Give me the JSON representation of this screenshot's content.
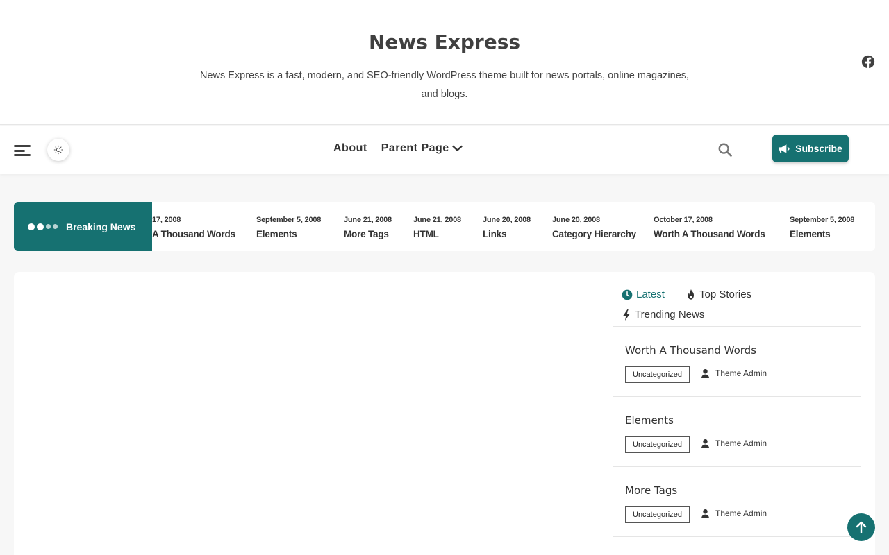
{
  "site": {
    "title": "News Express",
    "description": "News Express is a fast, modern, and SEO-friendly WordPress theme built for news portals, online magazines, and blogs."
  },
  "nav": {
    "items": [
      {
        "label": "About",
        "has_dropdown": false
      },
      {
        "label": "Parent Page",
        "has_dropdown": true
      }
    ],
    "subscribe_label": "Subscribe"
  },
  "breaking": {
    "label": "Breaking News",
    "items": [
      {
        "date": "17, 2008",
        "title": "A Thousand Words"
      },
      {
        "date": "September 5, 2008",
        "title": "Elements"
      },
      {
        "date": "June 21, 2008",
        "title": "More Tags"
      },
      {
        "date": "June 21, 2008",
        "title": "HTML"
      },
      {
        "date": "June 20, 2008",
        "title": "Links"
      },
      {
        "date": "June 20, 2008",
        "title": "Category Hierarchy"
      },
      {
        "date": "October 17, 2008",
        "title": "Worth A Thousand Words"
      },
      {
        "date": "September 5, 2008",
        "title": "Elements"
      }
    ]
  },
  "tabs": [
    {
      "label": "Latest",
      "icon": "clock-icon",
      "active": true
    },
    {
      "label": "Top Stories",
      "icon": "fire-icon",
      "active": false
    },
    {
      "label": "Trending News",
      "icon": "bolt-icon",
      "active": false
    }
  ],
  "posts": [
    {
      "title": "Worth A Thousand Words",
      "category": "Uncategorized",
      "author": "Theme Admin"
    },
    {
      "title": "Elements",
      "category": "Uncategorized",
      "author": "Theme Admin"
    },
    {
      "title": "More Tags",
      "category": "Uncategorized",
      "author": "Theme Admin"
    }
  ],
  "colors": {
    "accent": "#167171",
    "text": "#333333",
    "background": "#f7f7f7"
  }
}
